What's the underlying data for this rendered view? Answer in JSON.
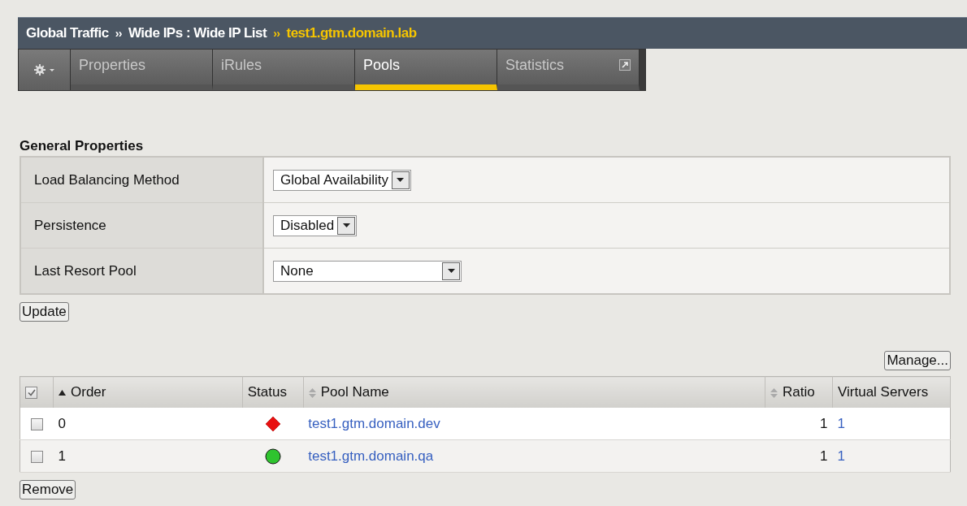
{
  "breadcrumb": {
    "items": [
      "Global Traffic",
      "Wide IPs : Wide IP List"
    ],
    "current": "test1.gtm.domain.lab",
    "separator": "››"
  },
  "tabs": [
    {
      "label": "Properties",
      "selected": false,
      "popout": false
    },
    {
      "label": "iRules",
      "selected": false,
      "popout": false
    },
    {
      "label": "Pools",
      "selected": true,
      "popout": false
    },
    {
      "label": "Statistics",
      "selected": false,
      "popout": true
    }
  ],
  "general_properties": {
    "title": "General Properties",
    "rows": [
      {
        "label": "Load Balancing Method",
        "value": "Global Availability"
      },
      {
        "label": "Persistence",
        "value": "Disabled"
      },
      {
        "label": "Last Resort Pool",
        "value": "None"
      }
    ],
    "button": "Update"
  },
  "pools": {
    "manage_button": "Manage...",
    "select_all": {
      "checked": true
    },
    "columns": [
      {
        "label": "Order",
        "sortable": true,
        "sorted": true
      },
      {
        "label": "Status",
        "sortable": false
      },
      {
        "label": "Pool Name",
        "sortable": true
      },
      {
        "label": "Ratio",
        "sortable": true
      },
      {
        "label": "Virtual Servers",
        "sortable": false
      }
    ],
    "rows": [
      {
        "checked": false,
        "order": "0",
        "kind": "diamond",
        "name": "test1.gtm.domain.dev",
        "ratio": "1",
        "virtual_servers": "1"
      },
      {
        "checked": false,
        "order": "1",
        "kind": "circle",
        "name": "test1.gtm.domain.qa",
        "ratio": "1",
        "virtual_servers": "1"
      }
    ],
    "remove_button": "Remove"
  }
}
